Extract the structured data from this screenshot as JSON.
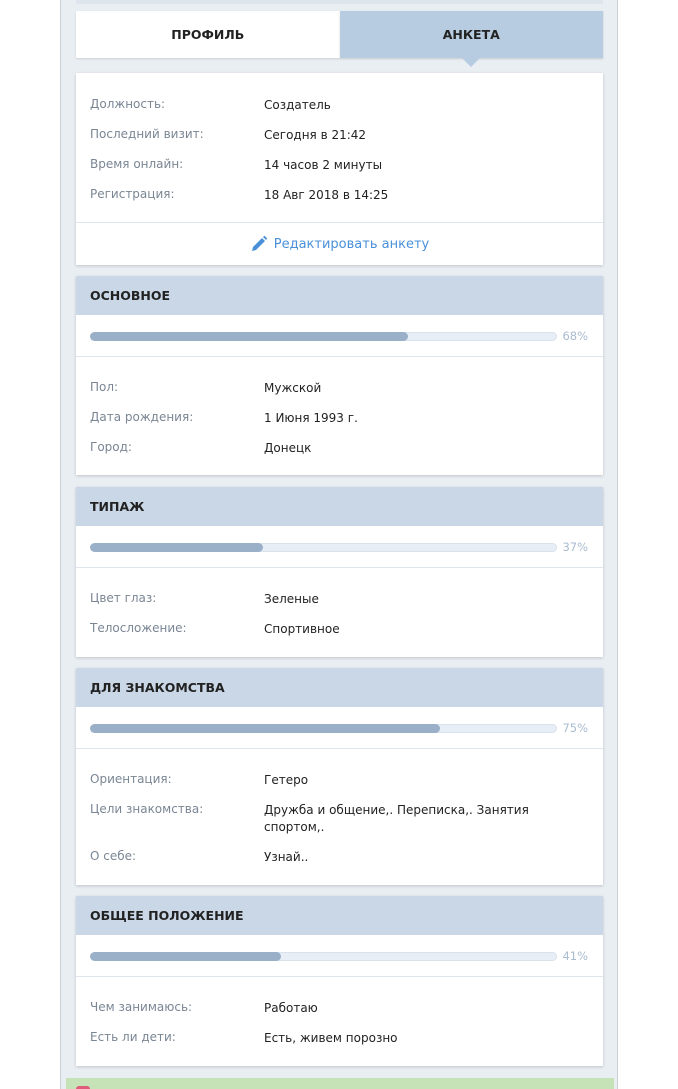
{
  "tabs": {
    "profile": "ПРОФИЛЬ",
    "anketa": "АНКЕТА"
  },
  "summary": {
    "rows": [
      {
        "label": "Должность:",
        "value": "Создатель"
      },
      {
        "label": "Последний визит:",
        "value": "Сегодня в 21:42"
      },
      {
        "label": "Время онлайн:",
        "value": "14 часов 2 минуты"
      },
      {
        "label": "Регистрация:",
        "value": "18 Авг 2018 в 14:25"
      }
    ],
    "edit_label": "Редактировать анкету"
  },
  "sections": [
    {
      "title": "ОСНОВНОЕ",
      "percent_label": "68%",
      "progress": 0.68,
      "rows": [
        {
          "label": "Пол:",
          "value": "Мужской"
        },
        {
          "label": "Дата рождения:",
          "value": "1 Июня 1993 г."
        },
        {
          "label": "Город:",
          "value": "Донецк"
        }
      ]
    },
    {
      "title": "ТИПАЖ",
      "percent_label": "37%",
      "progress": 0.37,
      "rows": [
        {
          "label": "Цвет глаз:",
          "value": "Зеленые"
        },
        {
          "label": "Телосложение:",
          "value": "Спортивное"
        }
      ]
    },
    {
      "title": "ДЛЯ ЗНАКОМСТВА",
      "percent_label": "75%",
      "progress": 0.75,
      "rows": [
        {
          "label": "Ориентация:",
          "value": "Гетеро"
        },
        {
          "label": "Цели знакомства:",
          "value": "Дружба и общение,. Переписка,. Занятия спортом,."
        },
        {
          "label": "О себе:",
          "value": "Узнай.."
        }
      ]
    },
    {
      "title": "ОБЩЕЕ ПОЛОЖЕНИЕ",
      "percent_label": "41%",
      "progress": 0.41,
      "rows": [
        {
          "label": "Чем занимаюсь:",
          "value": "Работаю"
        },
        {
          "label": "Есть ли дети:",
          "value": "Есть, живем порозно"
        }
      ]
    }
  ],
  "colors": {
    "accent": "#4a90d9",
    "tab_active": "#b7cbe1",
    "section_header": "#c9d7e6",
    "progress_fill": "#9ab0c8"
  },
  "icons": {
    "edit": "pencil-icon"
  }
}
